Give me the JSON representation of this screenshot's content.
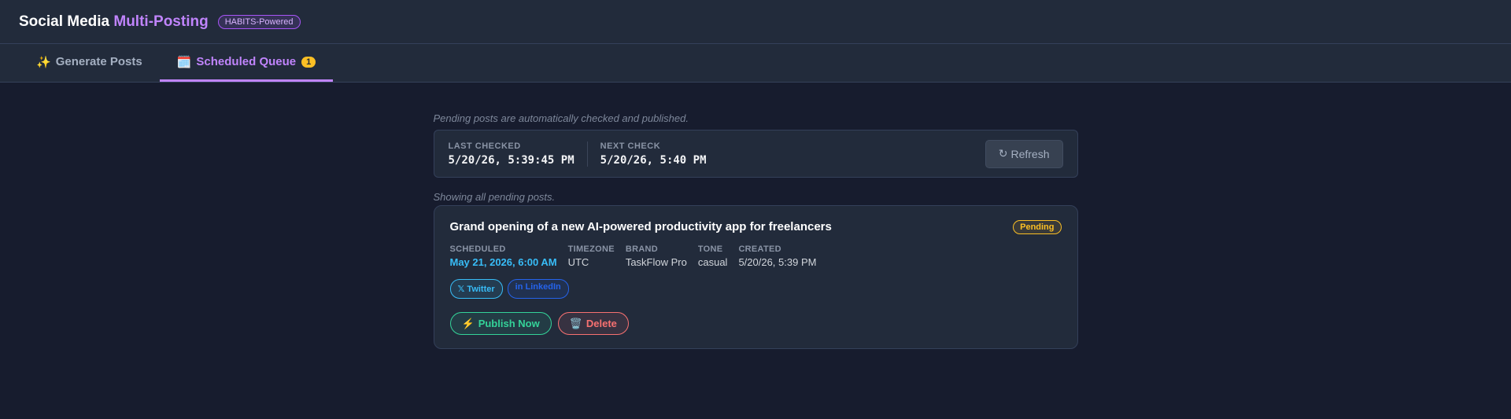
{
  "header": {
    "title_main": "Social Media ",
    "title_accent": "Multi-Posting",
    "badge": "HABITS-Powered"
  },
  "tabs": [
    {
      "icon": "✨",
      "label": "Generate Posts"
    },
    {
      "icon": "🗓️",
      "label": "Scheduled Queue",
      "count": "1"
    }
  ],
  "queue": {
    "auto_note": "Pending posts are automatically checked and published.",
    "last_checked_label": "LAST CHECKED",
    "last_checked_value": "5/20/26, 5:39:45 PM",
    "next_check_label": "NEXT CHECK",
    "next_check_value": "5/20/26, 5:40 PM",
    "refresh_icon": "↻",
    "refresh_label": "Refresh",
    "showing_note": "Showing all pending posts."
  },
  "post": {
    "title": "Grand opening of a new AI-powered productivity app for freelancers",
    "status": "Pending",
    "meta": {
      "scheduled_label": "SCHEDULED",
      "scheduled_value": "May 21, 2026, 6:00 AM",
      "timezone_label": "TIMEZONE",
      "timezone_value": "UTC",
      "brand_label": "BRAND",
      "brand_value": "TaskFlow Pro",
      "tone_label": "TONE",
      "tone_value": "casual",
      "created_label": "CREATED",
      "created_value": "5/20/26, 5:39 PM"
    },
    "platforms": [
      "𝕏 Twitter",
      "in LinkedIn"
    ],
    "publish_icon": "⚡",
    "publish_label": "Publish Now",
    "delete_icon": "🗑️",
    "delete_label": "Delete"
  },
  "colors": {
    "background": "#171c2e",
    "accent": "#c084fc",
    "pending": "#fbbf24",
    "scheduled": "#38bdf8",
    "publish": "#34d399",
    "delete": "#f87171"
  }
}
